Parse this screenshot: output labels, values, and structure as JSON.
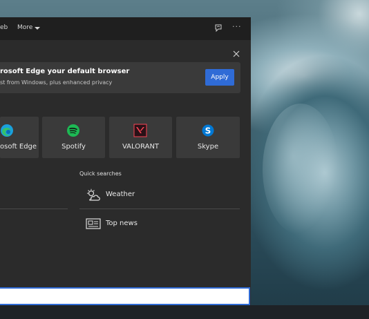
{
  "top_bar": {
    "tab_web": "eb",
    "tab_more": "More"
  },
  "banner": {
    "title": "rosoft Edge your default browser",
    "subtitle": "st from Windows, plus enhanced privacy",
    "apply_label": "Apply"
  },
  "top_apps": [
    {
      "label": "osoft Edge",
      "icon": "edge-icon"
    },
    {
      "label": "Spotify",
      "icon": "spotify-icon"
    },
    {
      "label": "VALORANT",
      "icon": "valorant-icon"
    },
    {
      "label": "Skype",
      "icon": "skype-icon"
    }
  ],
  "quick_searches": {
    "heading": "Quick searches",
    "items": [
      {
        "label": "Weather",
        "icon": "weather-icon"
      },
      {
        "label": "Top news",
        "icon": "news-icon"
      }
    ]
  },
  "colors": {
    "accent": "#2f6bd6",
    "panel_bg": "#2b2b2b",
    "tile_bg": "#3a3a3a",
    "spotify": "#1db954",
    "valorant": "#fa4454",
    "skype": "#0078d4"
  }
}
